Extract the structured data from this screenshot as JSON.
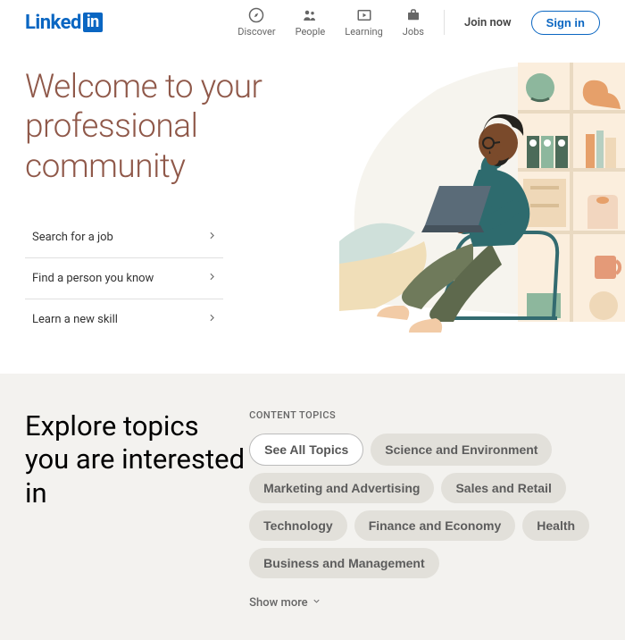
{
  "logo": {
    "text": "Linked",
    "badge": "in"
  },
  "nav": {
    "items": [
      {
        "label": "Discover"
      },
      {
        "label": "People"
      },
      {
        "label": "Learning"
      },
      {
        "label": "Jobs"
      }
    ],
    "join": "Join now",
    "signin": "Sign in"
  },
  "hero": {
    "title": "Welcome to your professional community",
    "links": [
      {
        "label": "Search for a job"
      },
      {
        "label": "Find a person you know"
      },
      {
        "label": "Learn a new skill"
      }
    ]
  },
  "topics": {
    "heading": "Explore topics you are interested in",
    "label": "CONTENT TOPICS",
    "pills": [
      "See All Topics",
      "Science and Environment",
      "Marketing and Advertising",
      "Sales and Retail",
      "Technology",
      "Finance and Economy",
      "Health",
      "Business and Management"
    ],
    "show_more": "Show more"
  }
}
